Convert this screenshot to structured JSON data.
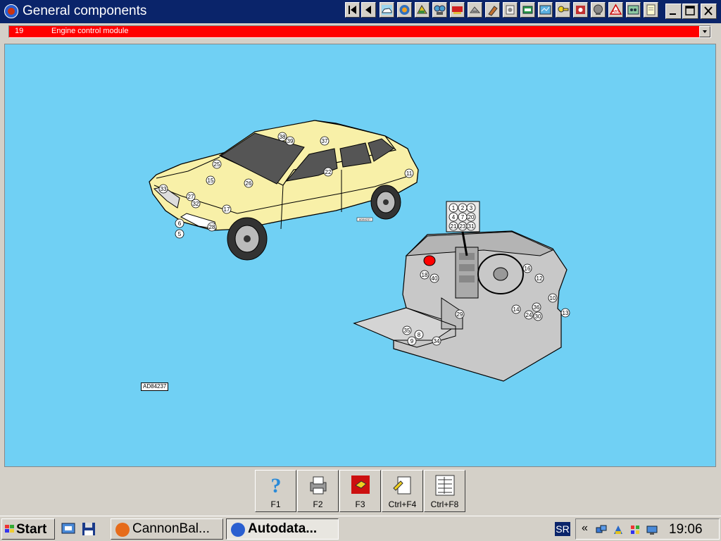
{
  "window": {
    "title": "General components"
  },
  "toolbar": {
    "icons": [
      "first-icon",
      "previous-icon",
      "car-image-icon",
      "engine-icon",
      "electrical-icon",
      "diagnostics-icon",
      "repair-times-icon",
      "tyres-icon",
      "service-icon",
      "timing-belt-icon",
      "battery-icon",
      "air-con-icon",
      "key-programming-icon",
      "brakes-icon",
      "camshaft-icon",
      "abs-icon",
      "ecu-icon",
      "wiring-icon",
      "notes-icon"
    ]
  },
  "selector": {
    "code": "19",
    "label": "Engine control module"
  },
  "diagram": {
    "ref_label": "AD84237",
    "ref_small": "AD84237",
    "car_callouts": [
      "38",
      "39",
      "37",
      "25",
      "15",
      "26",
      "22",
      "11",
      "33",
      "27",
      "32",
      "17",
      "6",
      "28",
      "5"
    ],
    "dash_callouts": [
      "1",
      "2",
      "3",
      "4",
      "7",
      "20",
      "21",
      "23",
      "31",
      "16",
      "18",
      "40",
      "12",
      "10",
      "14",
      "36",
      "24",
      "30",
      "13",
      "29",
      "35",
      "8",
      "9",
      "34"
    ]
  },
  "function_keys": [
    {
      "label": "F1",
      "icon": "help-icon"
    },
    {
      "label": "F2",
      "icon": "print-icon"
    },
    {
      "label": "F3",
      "icon": "hand-icon"
    },
    {
      "label": "Ctrl+F4",
      "icon": "note-icon"
    },
    {
      "label": "Ctrl+F8",
      "icon": "list-icon"
    }
  ],
  "taskbar": {
    "start_label": "Start",
    "tasks": [
      {
        "label": "CannonBal...",
        "active": false
      },
      {
        "label": "Autodata...",
        "active": true
      }
    ],
    "language": "SR",
    "chevron": "«",
    "clock": "19:06"
  },
  "colors": {
    "canvas": "#70d0f4",
    "selector": "#ff0000",
    "titlebar": "#0a246a",
    "car_body": "#f8f0a8",
    "dash": "#c8c8c8",
    "highlight": "#ff0000"
  }
}
